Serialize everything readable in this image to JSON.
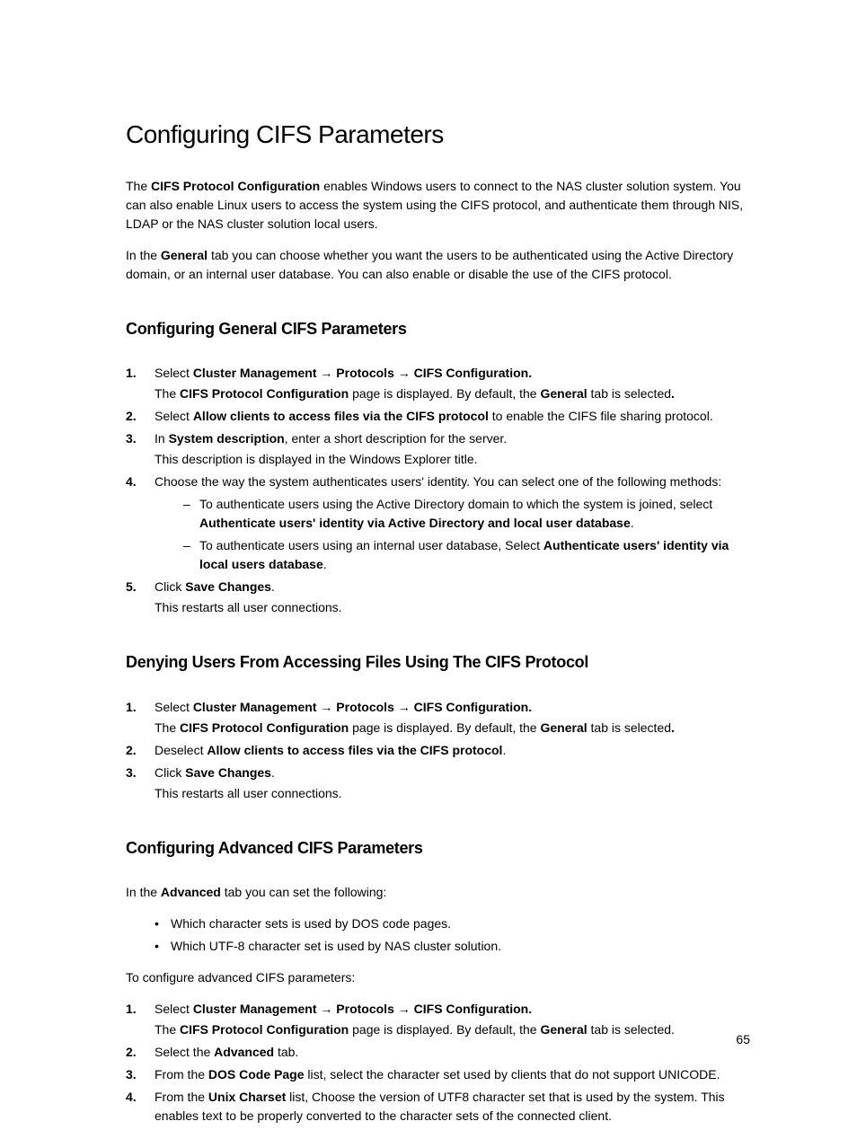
{
  "page": {
    "title": "Configuring CIFS Parameters",
    "intro1_pre": "The ",
    "intro1_bold": "CIFS Protocol Configuration",
    "intro1_post": " enables Windows users to connect to the NAS cluster solution system. You can also enable Linux users to access the system using the CIFS protocol, and authenticate them through NIS, LDAP or the NAS cluster solution local users.",
    "intro2_pre": "In the ",
    "intro2_bold": "General",
    "intro2_post": " tab you can choose whether you want the users to be authenticated using the Active Directory domain, or an internal user database. You can also enable or disable the use of the CIFS protocol.",
    "pageNumber": "65"
  },
  "sectionA": {
    "title": "Configuring General CIFS Parameters",
    "step1_pre": "Select ",
    "step1_b1": "Cluster Management",
    "step1_arrow1": " → ",
    "step1_b2": "Protocols",
    "step1_arrow2": " → ",
    "step1_b3": "CIFS Configuration.",
    "step1_sub_pre": "The ",
    "step1_sub_b1": "CIFS Protocol Configuration",
    "step1_sub_mid": " page is displayed. By default, the ",
    "step1_sub_b2": "General",
    "step1_sub_post": " tab is selected",
    "step1_sub_dot_bold": ".",
    "step2_pre": "Select ",
    "step2_b": "Allow clients to access files via the CIFS protocol",
    "step2_post": " to enable the CIFS file sharing protocol.",
    "step3_pre": "In ",
    "step3_b": "System description",
    "step3_post": ", enter a short description for the server.",
    "step3_sub": "This description is displayed in the Windows Explorer title.",
    "step4_text": "Choose the way the system authenticates users' identity. You can select one of the following methods:",
    "step4_dash1_pre": "To authenticate users using the Active Directory domain to which the system is joined, select ",
    "step4_dash1_b": "Authenticate users' identity via Active Directory and local user database",
    "step4_dash1_post": ".",
    "step4_dash2_pre": "To authenticate users using an internal user database, Select ",
    "step4_dash2_b": "Authenticate users' identity via local users database",
    "step4_dash2_post": ".",
    "step5_pre": "Click ",
    "step5_b": "Save Changes",
    "step5_post": ".",
    "step5_sub": "This restarts all user connections."
  },
  "sectionB": {
    "title": "Denying Users From Accessing Files Using The CIFS Protocol",
    "step1_pre": "Select ",
    "step1_b1": "Cluster Management",
    "step1_arrow1": " → ",
    "step1_b2": "Protocols",
    "step1_arrow2": " → ",
    "step1_b3": "CIFS Configuration.",
    "step1_sub_pre": "The ",
    "step1_sub_b1": "CIFS Protocol Configuration",
    "step1_sub_mid": " page is displayed. By default, the ",
    "step1_sub_b2": "General",
    "step1_sub_post": " tab is selected",
    "step1_sub_dot_bold": ".",
    "step2_pre": "Deselect ",
    "step2_b": "Allow clients to access files via the CIFS protocol",
    "step2_post": ".",
    "step3_pre": "Click ",
    "step3_b": "Save Changes",
    "step3_post": ".",
    "step3_sub": "This restarts all user connections."
  },
  "sectionC": {
    "title": "Configuring Advanced CIFS Parameters",
    "intro_pre": "In the ",
    "intro_b": "Advanced",
    "intro_post": " tab you can set the following:",
    "bullet1": "Which character sets is used by DOS code pages.",
    "bullet2": "Which UTF-8 character set is used by NAS cluster solution.",
    "leadIn": "To configure advanced CIFS parameters:",
    "step1_pre": "Select ",
    "step1_b1": "Cluster Management",
    "step1_arrow1": " → ",
    "step1_b2": "Protocols",
    "step1_arrow2": " → ",
    "step1_b3": "CIFS Configuration.",
    "step1_sub_pre": "The ",
    "step1_sub_b1": "CIFS Protocol Configuration",
    "step1_sub_mid": " page is displayed. By default, the ",
    "step1_sub_b2": "General",
    "step1_sub_post": " tab is selected.",
    "step2_pre": "Select the ",
    "step2_b": "Advanced",
    "step2_post": " tab.",
    "step3_pre": "From the ",
    "step3_b": "DOS Code Page",
    "step3_post": " list, select the character set used by clients that do not support UNICODE.",
    "step4_pre": "From the ",
    "step4_b": "Unix Charset",
    "step4_post": " list, Choose the version of UTF8 character set that is used by the system. This enables text to be properly converted to the character sets of the connected client."
  }
}
